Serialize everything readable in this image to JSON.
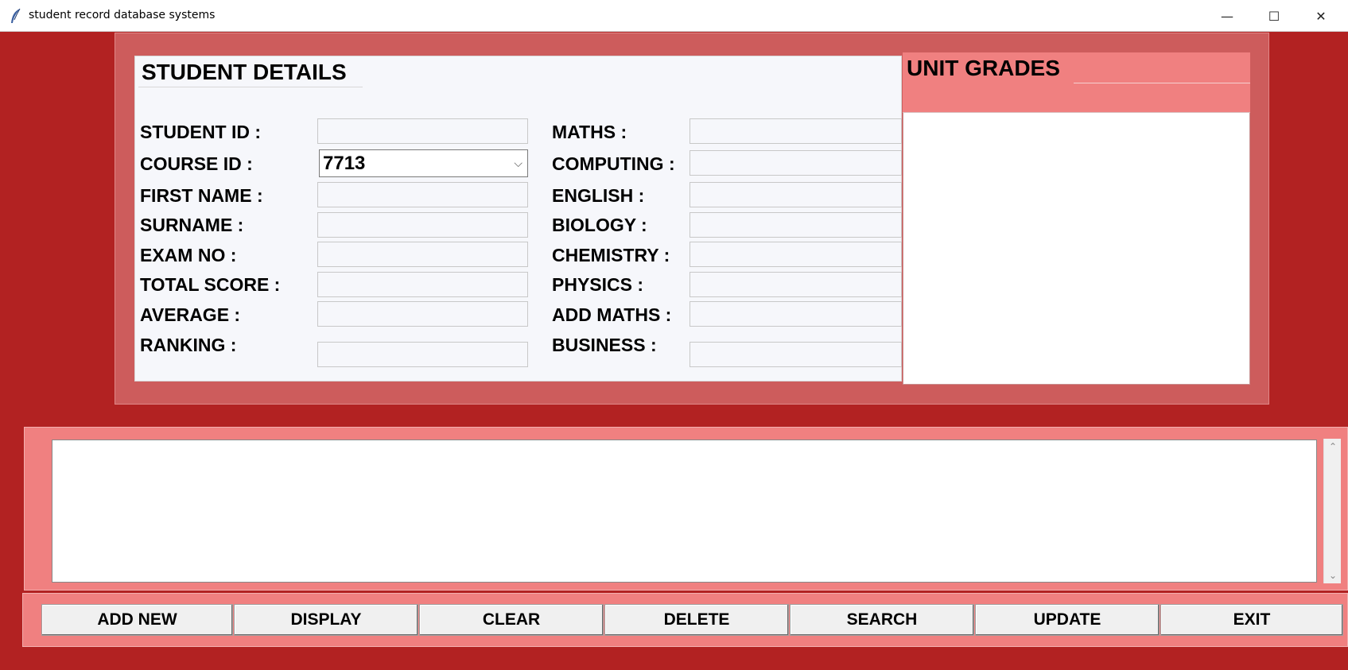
{
  "window": {
    "title": "student record database systems",
    "minimize_glyph": "—",
    "maximize_glyph": "☐",
    "close_glyph": "✕",
    "app_icon": "feather-icon"
  },
  "student_details": {
    "title": "STUDENT DETAILS",
    "fields": [
      {
        "label": "STUDENT ID :",
        "value": ""
      },
      {
        "label": "COURSE ID :",
        "value": "7713"
      },
      {
        "label": "FIRST NAME :",
        "value": ""
      },
      {
        "label": "SURNAME :",
        "value": ""
      },
      {
        "label": "EXAM NO :",
        "value": ""
      },
      {
        "label": "TOTAL SCORE :",
        "value": ""
      },
      {
        "label": "AVERAGE :",
        "value": ""
      },
      {
        "label": "RANKING :",
        "value": ""
      }
    ],
    "subjects": [
      {
        "label": "MATHS :",
        "value": ""
      },
      {
        "label": "COMPUTING :",
        "value": ""
      },
      {
        "label": "ENGLISH :",
        "value": ""
      },
      {
        "label": "BIOLOGY :",
        "value": ""
      },
      {
        "label": "CHEMISTRY :",
        "value": ""
      },
      {
        "label": "PHYSICS :",
        "value": ""
      },
      {
        "label": "ADD MATHS :",
        "value": ""
      },
      {
        "label": "BUSINESS :",
        "value": ""
      }
    ]
  },
  "unit_grades": {
    "title": "UNIT GRADES"
  },
  "scrollbar": {
    "up_glyph": "⌃",
    "down_glyph": "⌄"
  },
  "buttons": {
    "add_new": "ADD NEW",
    "display": "DISPLAY",
    "clear": "CLEAR",
    "delete": "DELETE",
    "search": "SEARCH",
    "update": "UPDATE",
    "exit": "EXIT"
  },
  "colors": {
    "background": "#b22222",
    "frame": "#cd5c5c",
    "panel": "#f08080",
    "form": "#f6f7fb"
  }
}
